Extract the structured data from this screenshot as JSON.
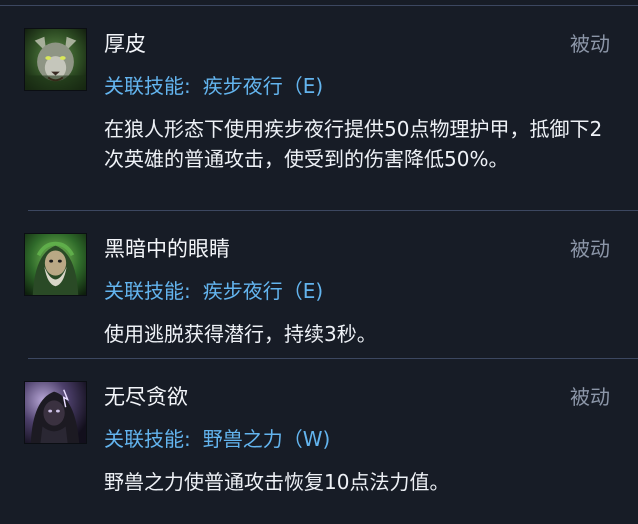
{
  "talents": [
    {
      "name": "厚皮",
      "type": "被动",
      "linked_label": "关联技能:",
      "linked_skill": "疾步夜行（E)",
      "description": "在狼人形态下使用疾步夜行提供50点物理护甲，抵御下2次英雄的普通攻击，使受到的伤害降低50%。",
      "icon": "werewolf-portrait-icon"
    },
    {
      "name": "黑暗中的眼睛",
      "type": "被动",
      "linked_label": "关联技能:",
      "linked_skill": "疾步夜行（E)",
      "description": "使用逃脱获得潜行，持续3秒。",
      "icon": "hooded-figure-icon"
    },
    {
      "name": "无尽贪欲",
      "type": "被动",
      "linked_label": "关联技能:",
      "linked_skill": "野兽之力（W)",
      "description": "野兽之力使普通攻击恢复10点法力值。",
      "icon": "dark-hooded-figure-icon"
    }
  ]
}
